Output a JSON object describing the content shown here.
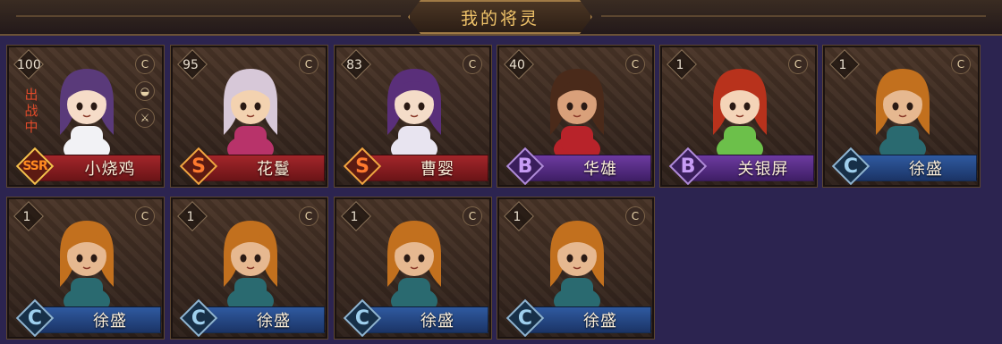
{
  "header": {
    "title": "我的将灵"
  },
  "status_text": "出战中",
  "badge_icons": {
    "c": "C",
    "hat": "◒",
    "sword": "⚔"
  },
  "cards": [
    {
      "level": "100",
      "rank": "SSR",
      "rank_style": "ssr",
      "name": "小烧鸡",
      "plate": "red",
      "deployed": true,
      "extra_badges": true,
      "hair": "#5a3a7a",
      "skin": "#f6dcc8",
      "outfit": "#f2f2f5"
    },
    {
      "level": "95",
      "rank": "S",
      "rank_style": "s",
      "name": "花鬘",
      "plate": "red",
      "deployed": false,
      "extra_badges": false,
      "hair": "#d7c8d8",
      "skin": "#f3d2b0",
      "outfit": "#b8336a"
    },
    {
      "level": "83",
      "rank": "S",
      "rank_style": "s",
      "name": "曹婴",
      "plate": "red",
      "deployed": false,
      "extra_badges": false,
      "hair": "#5a2f7a",
      "skin": "#f4dcc8",
      "outfit": "#e8e4f0"
    },
    {
      "level": "40",
      "rank": "B",
      "rank_style": "b",
      "name": "华雄",
      "plate": "purple",
      "deployed": false,
      "extra_badges": false,
      "hair": "#4a2a1a",
      "skin": "#d9a07a",
      "outfit": "#b8232a"
    },
    {
      "level": "1",
      "rank": "B",
      "rank_style": "b",
      "name": "关银屏",
      "plate": "purple",
      "deployed": false,
      "extra_badges": false,
      "hair": "#b8321c",
      "skin": "#f4d4b8",
      "outfit": "#6cc04a"
    },
    {
      "level": "1",
      "rank": "C",
      "rank_style": "c",
      "name": "徐盛",
      "plate": "blue",
      "deployed": false,
      "extra_badges": false,
      "hair": "#c2701e",
      "skin": "#e6b890",
      "outfit": "#2a6a70"
    },
    {
      "level": "1",
      "rank": "C",
      "rank_style": "c",
      "name": "徐盛",
      "plate": "blue",
      "deployed": false,
      "extra_badges": false,
      "hair": "#c2701e",
      "skin": "#e6b890",
      "outfit": "#2a6a70"
    },
    {
      "level": "1",
      "rank": "C",
      "rank_style": "c",
      "name": "徐盛",
      "plate": "blue",
      "deployed": false,
      "extra_badges": false,
      "hair": "#c2701e",
      "skin": "#e6b890",
      "outfit": "#2a6a70"
    },
    {
      "level": "1",
      "rank": "C",
      "rank_style": "c",
      "name": "徐盛",
      "plate": "blue",
      "deployed": false,
      "extra_badges": false,
      "hair": "#c2701e",
      "skin": "#e6b890",
      "outfit": "#2a6a70"
    },
    {
      "level": "1",
      "rank": "C",
      "rank_style": "c",
      "name": "徐盛",
      "plate": "blue",
      "deployed": false,
      "extra_badges": false,
      "hair": "#c2701e",
      "skin": "#e6b890",
      "outfit": "#2a6a70"
    }
  ]
}
